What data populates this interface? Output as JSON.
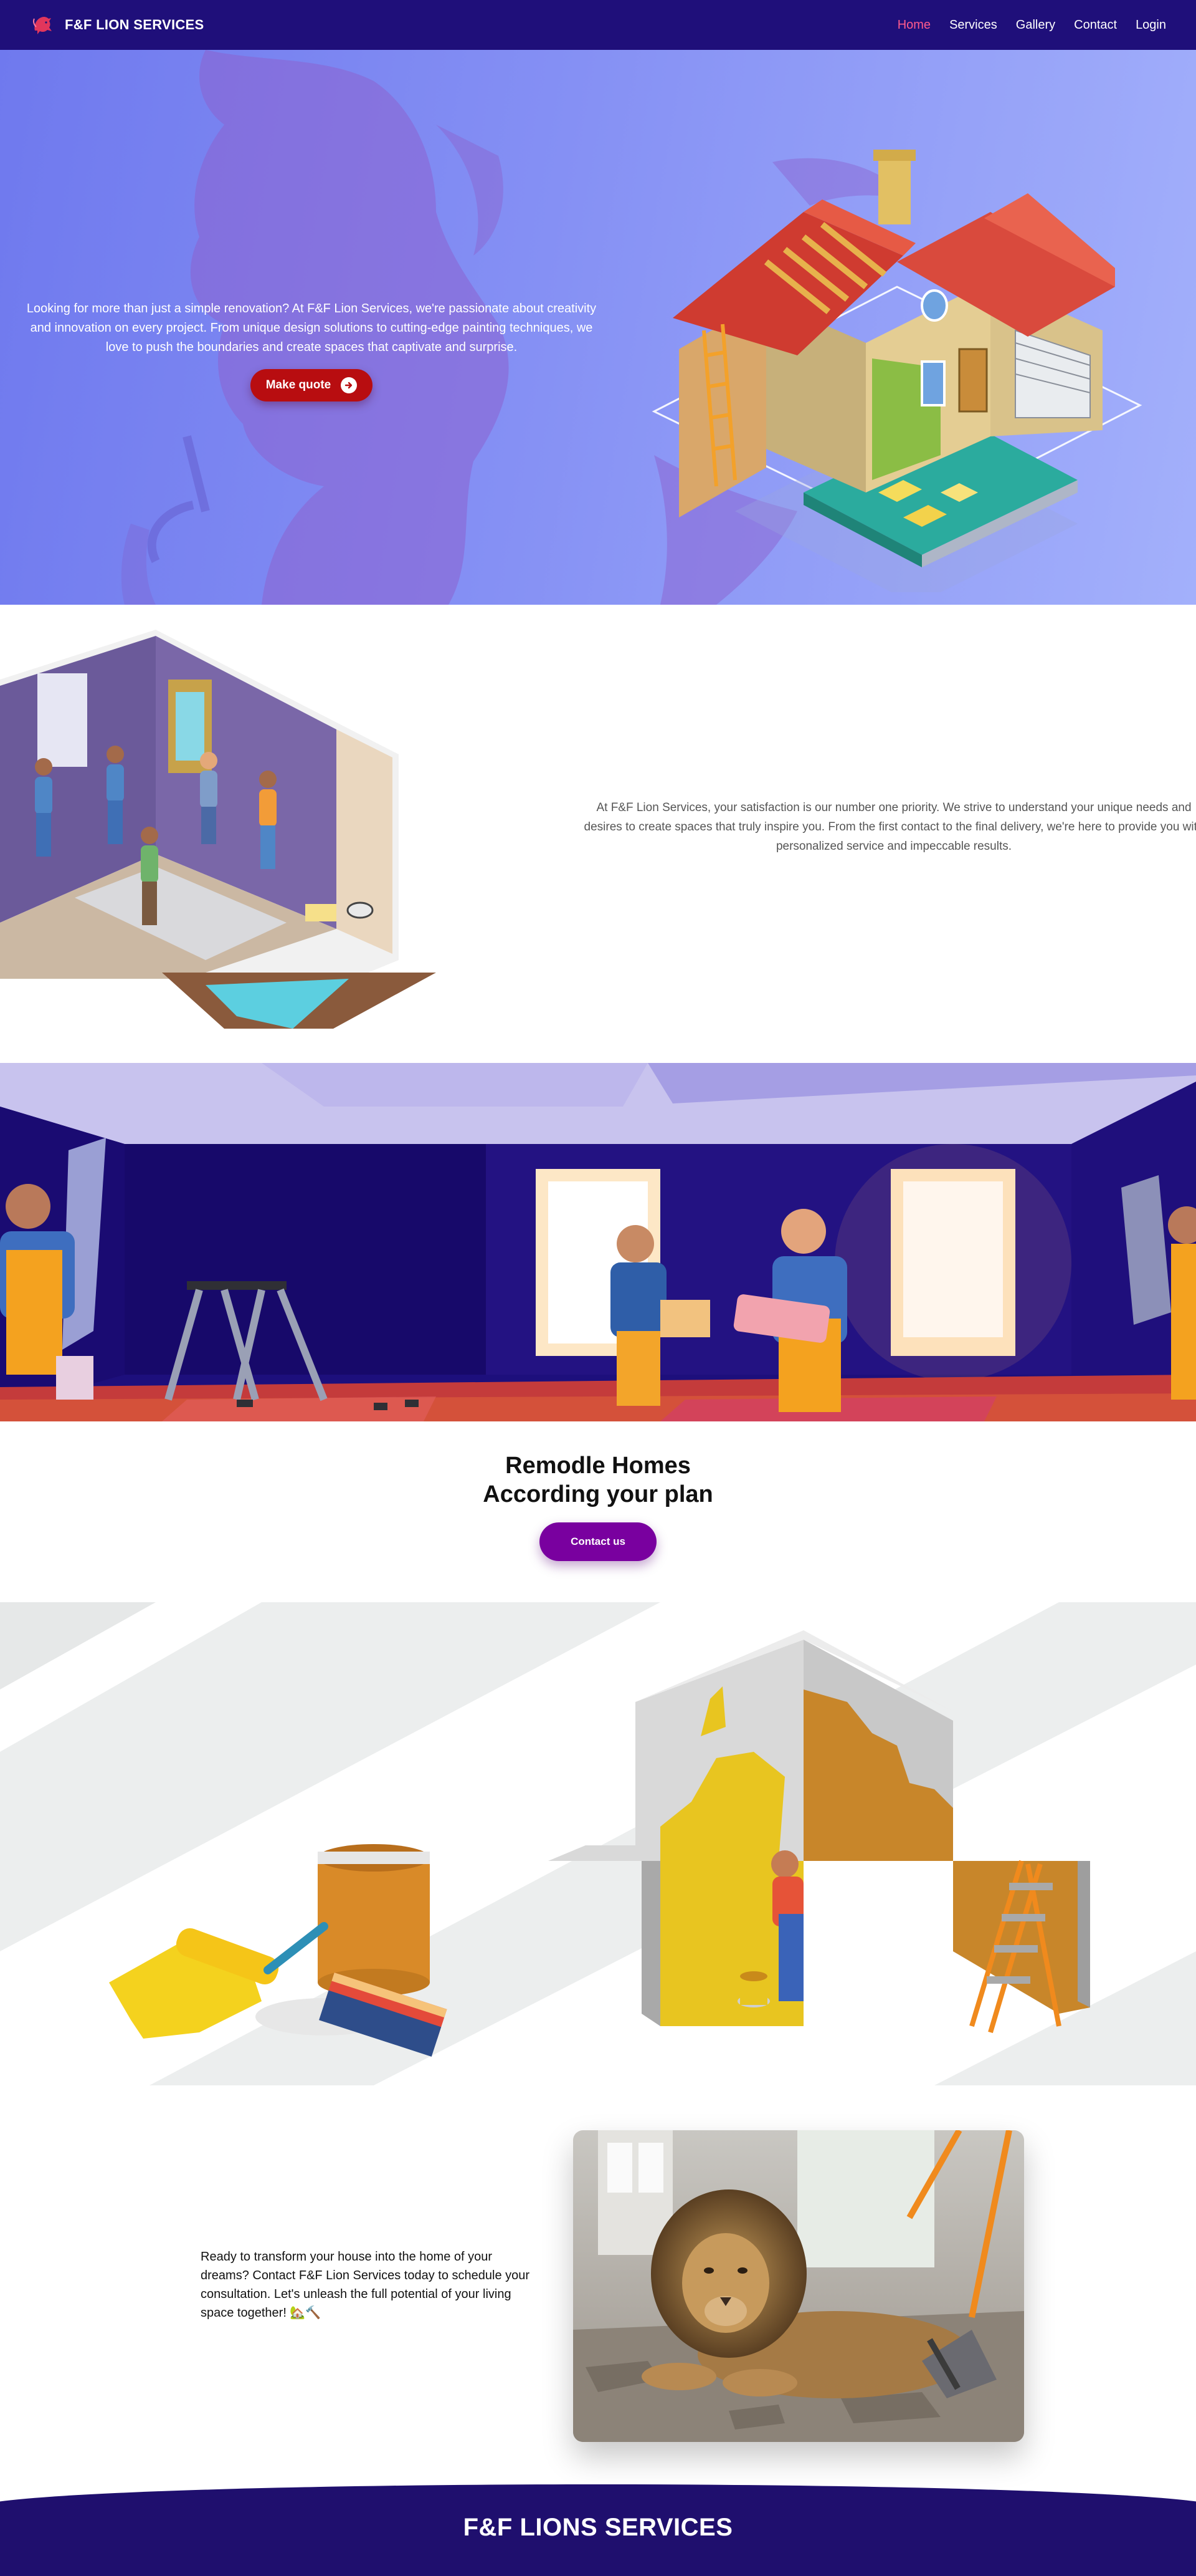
{
  "nav": {
    "brand": "F&F LION SERVICES",
    "items": [
      {
        "label": "Home",
        "active": true
      },
      {
        "label": "Services",
        "active": false
      },
      {
        "label": "Gallery",
        "active": false
      },
      {
        "label": "Contact",
        "active": false
      },
      {
        "label": "Login",
        "active": false
      }
    ]
  },
  "hero": {
    "text": "Looking for more than just a simple renovation? At F&F Lion Services, we're passionate about creativity and innovation on every project. From unique design solutions to cutting-edge painting techniques, we love to push the boundaries and create spaces that captivate and surprise.",
    "button_label": "Make quote"
  },
  "about": {
    "text": "At F&F Lion Services, your satisfaction is our number one priority. We strive to understand your unique needs and desires to create spaces that truly inspire you. From the first contact to the final delivery, we're here to provide you with personalized service and impeccable results."
  },
  "cta": {
    "title_line1": "Remodle Homes",
    "title_line2": "According your plan",
    "button_label": "Contact us"
  },
  "promo": {
    "text": "Ready to transform your house into the home of your dreams? Contact F&F Lion Services today to schedule your consultation. Let's unleash the full potential of your living space together! 🏡🔨"
  },
  "footer": {
    "title": "F&F LIONS SERVICES"
  },
  "colors": {
    "nav_bg": "#1f0f7a",
    "nav_active": "#ff5b8d",
    "hero_gradient_start": "#6f79ee",
    "hero_gradient_end": "#a3b0fb",
    "quote_button": "#b80d10",
    "contact_button": "#79009f",
    "footer_bg": "#1f0f6e"
  },
  "icons": [
    "lion-logo-icon",
    "arrow-right-circle-icon"
  ]
}
